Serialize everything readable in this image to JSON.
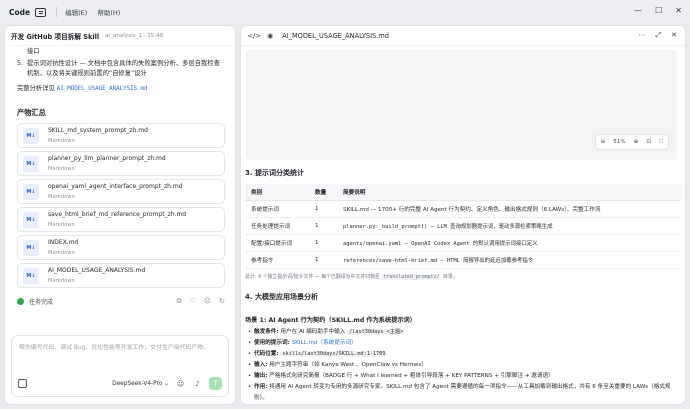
{
  "topbar": {
    "app_name": "Code",
    "menus": [
      "编辑(E)",
      "帮助(H)"
    ]
  },
  "left": {
    "project_title": "开发 GitHub 项目拆解 Skill",
    "project_sub": "ai_analysis_1 · 15:48",
    "truncated_line": "接口",
    "numbered": [
      {
        "n": "5.",
        "text": "提示词对抗性设计 — 文档中包含具体的失败案例分析、多层自我检查机制，以及将关键规则前置的“自修复”设计"
      }
    ],
    "analysis_prefix": "完整分析详见 ",
    "analysis_link": "AI_MODEL_USAGE_ANALYSIS.md",
    "outputs_heading": "产物汇总",
    "files": [
      {
        "name": "SKILL_md_system_prompt_zh.md",
        "type": "Markdown"
      },
      {
        "name": "planner_py_llm_planner_prompt_zh.md",
        "type": "Markdown"
      },
      {
        "name": "openai_yaml_agent_interface_prompt_zh.md",
        "type": "Markdown"
      },
      {
        "name": "save_html_brief_md_reference_prompt_zh.md",
        "type": "Markdown"
      },
      {
        "name": "INDEX.md",
        "type": "Markdown"
      },
      {
        "name": "AI_MODEL_USAGE_ANALYSIS.md",
        "type": "Markdown"
      }
    ],
    "badge": "M↓",
    "status": "任务完成",
    "composer_placeholder": "帮你编写代码、调试 Bug、优化性能等开发工作，交付生产级代码产物。",
    "model": "DeepSeek-V4-Pro ⌄"
  },
  "right": {
    "file_title": "AI_MODEL_USAGE_ANALYSIS.md",
    "zoom": "51%",
    "section3_title": "3. 提示词分类统计",
    "table_headers": [
      "类别",
      "数量",
      "简要说明"
    ],
    "table_rows": [
      {
        "cat": "系统提示词",
        "count": "1",
        "desc": "SKILL.md — 1700+ 行的完整 AI Agent 行为契约、定义角色、输出格式规则（6 LAWs）、完整工作流",
        "mono": false
      },
      {
        "cat": "任务处理提示词",
        "count": "1",
        "desc": "planner.py:_build_prompt() — LLM 查询规划器提示词，驱动多源检索策略生成",
        "mono": true
      },
      {
        "cat": "配置/接口提示词",
        "count": "1",
        "desc": "agents/openai.yaml — OpenAI Codex Agent 的默认调用提示词接口定义",
        "mono": true
      },
      {
        "cat": "参考指令",
        "count": "1",
        "desc": "references/save-html-brief.md — HTML 简报导出的延迟加载参考指令",
        "mono": true
      }
    ],
    "note_prefix": "总计: 4 个独立提示词/指令文件 — 每个已翻译为中文并归档至 ",
    "note_code": "translated_prompts/",
    "note_suffix": " 目录。",
    "section4_title": "4. 大模型应用场景分析",
    "scenario_title": "场景 1: AI Agent 行为契约（SKILL.md 作为系统提示词）",
    "bullets": [
      {
        "label": "触发条件:",
        "text": " 用户在 AI 编码助手中输入 ",
        "code": "/last30days <主题>"
      },
      {
        "label": "使用的提示词:",
        "text": " ",
        "link": "SKILL.md（系统提示词）"
      },
      {
        "label": "代码位置:",
        "text": " ",
        "code": "skills/last30days/SKILL.md:1-1709"
      },
      {
        "label": "输入:",
        "text": " 用户主题字符串（如 Kanye West 、OpenClaw vs Hermes）"
      },
      {
        "label": "输出:",
        "text": " 严格格式化研究简报（BADGE 行 + What I learned + 粗体引导段落 + KEY PATTERNS + 引擎脚注 + 邀请语）"
      },
      {
        "label": "作用:",
        "text": " 将通用 AI Agent 转变为专用的多源研究专家。SKILL.md 包含了 Agent 需要遵循的每一项指令——从工具加载到输出格式，共有 6 条至关重要的 LAWs（格式规则）。"
      }
    ]
  },
  "colors": {
    "accent": "#2b73d9",
    "success": "#2ea44f",
    "send": "#a7e0b4"
  }
}
